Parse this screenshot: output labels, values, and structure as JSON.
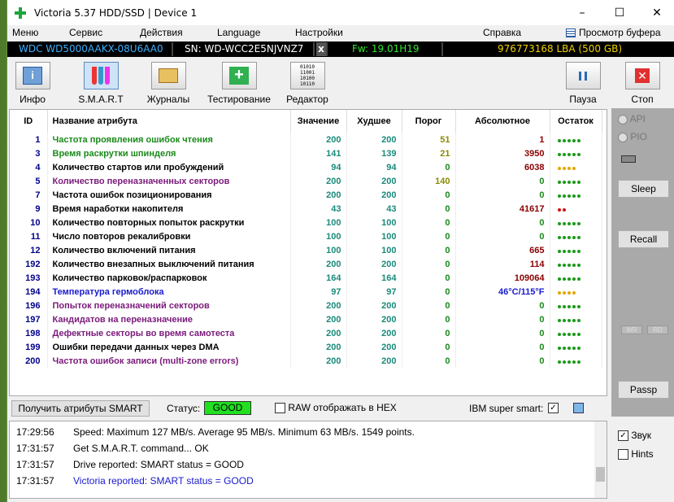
{
  "window": {
    "title": "Victoria 5.37 HDD/SSD | Device 1"
  },
  "menu": [
    "Меню",
    "Сервис",
    "Действия",
    "Language",
    "Настройки",
    "Справка",
    "Просмотр буфера"
  ],
  "info": {
    "model": "WDC WD5000AAKX-08U6AA0",
    "serial": "SN: WD-WCC2E5NJVNZ7",
    "close": "x",
    "fw": "Fw: 19.01H19",
    "lba": "976773168 LBA (500 GB)"
  },
  "toolbar": {
    "info": "Инфо",
    "smart": "S.M.A.R.T",
    "logs": "Журналы",
    "test": "Тестирование",
    "editor": "Редактор",
    "pause": "Пауза",
    "stop": "Стоп"
  },
  "table": {
    "headers": [
      "ID",
      "Название атрибута",
      "Значение",
      "Худшее",
      "Порог",
      "Абсолютное",
      "Остаток"
    ],
    "rows": [
      {
        "id": "1",
        "name": "Частота проявления ошибок чтения",
        "value": "200",
        "worst": "200",
        "thr": "51",
        "raw": "1",
        "rest": 5,
        "color": "#1a8a1a",
        "idc": "#00008b"
      },
      {
        "id": "3",
        "name": "Время раскрутки шпинделя",
        "value": "141",
        "worst": "139",
        "thr": "21",
        "raw": "3950",
        "rest": 5,
        "color": "#1a8a1a",
        "idc": "#00008b"
      },
      {
        "id": "4",
        "name": "Количество стартов или пробуждений",
        "value": "94",
        "worst": "94",
        "thr": "0",
        "raw": "6038",
        "rest": 4,
        "color": "#000",
        "idc": "#00008b"
      },
      {
        "id": "5",
        "name": "Количество переназначенных секторов",
        "value": "200",
        "worst": "200",
        "thr": "140",
        "raw": "0",
        "rest": 5,
        "color": "#7a1a7a",
        "idc": "#00008b"
      },
      {
        "id": "7",
        "name": "Частота ошибок позиционирования",
        "value": "200",
        "worst": "200",
        "thr": "0",
        "raw": "0",
        "rest": 5,
        "color": "#000",
        "idc": "#00008b"
      },
      {
        "id": "9",
        "name": "Время наработки накопителя",
        "value": "43",
        "worst": "43",
        "thr": "0",
        "raw": "41617",
        "rest": 2,
        "color": "#000",
        "idc": "#00008b"
      },
      {
        "id": "10",
        "name": "Количество повторных попыток раскрутки",
        "value": "100",
        "worst": "100",
        "thr": "0",
        "raw": "0",
        "rest": 5,
        "color": "#000",
        "idc": "#00008b"
      },
      {
        "id": "11",
        "name": "Число повторов рекалибровки",
        "value": "100",
        "worst": "100",
        "thr": "0",
        "raw": "0",
        "rest": 5,
        "color": "#000",
        "idc": "#00008b"
      },
      {
        "id": "12",
        "name": "Количество включений питания",
        "value": "100",
        "worst": "100",
        "thr": "0",
        "raw": "665",
        "rest": 5,
        "color": "#000",
        "idc": "#00008b"
      },
      {
        "id": "192",
        "name": "Количество внезапных выключений питания",
        "value": "200",
        "worst": "200",
        "thr": "0",
        "raw": "114",
        "rest": 5,
        "color": "#000",
        "idc": "#00008b"
      },
      {
        "id": "193",
        "name": "Количество парковок/распарковок",
        "value": "164",
        "worst": "164",
        "thr": "0",
        "raw": "109064",
        "rest": 5,
        "color": "#000",
        "idc": "#00008b"
      },
      {
        "id": "194",
        "name": "Температура гермоблока",
        "value": "97",
        "worst": "97",
        "thr": "0",
        "raw": "46°C/115°F",
        "rest": 4,
        "color": "#1a1acc",
        "idc": "#00008b"
      },
      {
        "id": "196",
        "name": "Попыток переназначений секторов",
        "value": "200",
        "worst": "200",
        "thr": "0",
        "raw": "0",
        "rest": 5,
        "color": "#7a1a7a",
        "idc": "#00008b"
      },
      {
        "id": "197",
        "name": "Кандидатов на переназначение",
        "value": "200",
        "worst": "200",
        "thr": "0",
        "raw": "0",
        "rest": 5,
        "color": "#7a1a7a",
        "idc": "#00008b"
      },
      {
        "id": "198",
        "name": "Дефектные секторы во время самотеста",
        "value": "200",
        "worst": "200",
        "thr": "0",
        "raw": "0",
        "rest": 5,
        "color": "#7a1a7a",
        "idc": "#00008b"
      },
      {
        "id": "199",
        "name": "Ошибки передачи данных через DMA",
        "value": "200",
        "worst": "200",
        "thr": "0",
        "raw": "0",
        "rest": 5,
        "color": "#000",
        "idc": "#00008b"
      },
      {
        "id": "200",
        "name": "Частота ошибок записи (multi-zone errors)",
        "value": "200",
        "worst": "200",
        "thr": "0",
        "raw": "0",
        "rest": 5,
        "color": "#7a1a7a",
        "idc": "#00008b"
      }
    ]
  },
  "right": {
    "api": "API",
    "pio": "PIO",
    "sleep": "Sleep",
    "recall": "Recall",
    "wr": "WR",
    "rd": "RD",
    "passp": "Passp",
    "sound": "Звук",
    "hints": "Hints"
  },
  "status": {
    "get_btn": "Получить атрибуты SMART",
    "label": "Статус:",
    "value": "GOOD",
    "raw_hex": "RAW отображать в HEX",
    "ibm": "IBM super smart:"
  },
  "log": [
    {
      "time": "17:29:56",
      "text": "Speed: Maximum 127 MB/s. Average 95 MB/s. Minimum 63 MB/s. 1549 points.",
      "color": "#000"
    },
    {
      "time": "17:31:57",
      "text": "Get S.M.A.R.T. command... OK",
      "color": "#000"
    },
    {
      "time": "17:31:57",
      "text": "Drive reported: SMART status = GOOD",
      "color": "#000"
    },
    {
      "time": "17:31:57",
      "text": "Victoria reported: SMART status = GOOD",
      "color": "#1a1acc"
    }
  ]
}
